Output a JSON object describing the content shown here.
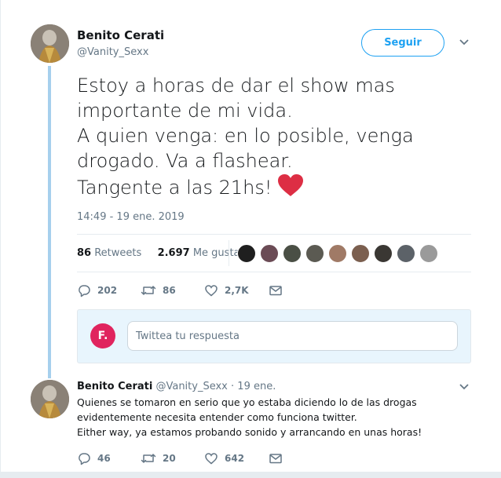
{
  "tweet": {
    "author_name": "Benito Cerati",
    "author_handle": "@Vanity_Sexx",
    "follow_label": "Seguir",
    "text_lines": [
      "Estoy a horas de dar el show mas",
      "importante de mi vida.",
      "A quien venga: en lo posible, venga",
      "drogado. Va a flashear.",
      "Tangente a las 21hs!"
    ],
    "timestamp": "14:49 - 19 ene. 2019",
    "retweets_count": "86",
    "retweets_label": "Retweets",
    "likes_count": "2.697",
    "likes_label": "Me gusta",
    "liker_colors": [
      "#1f1f1f",
      "#6b4b55",
      "#4a4f45",
      "#5b5a52",
      "#a07a66",
      "#7b5f4f",
      "#3a3733",
      "#5c6268",
      "#9a9a9a"
    ],
    "actions": {
      "replies": "202",
      "retweets": "86",
      "likes": "2,7K"
    }
  },
  "reply_composer": {
    "avatar_letter": "F.",
    "placeholder": "Twittea tu respuesta"
  },
  "reply": {
    "author_name": "Benito Cerati",
    "author_handle": "@Vanity_Sexx",
    "separator": "·",
    "date": "19 ene.",
    "text_lines": [
      "Quienes se tomaron en serio que yo estaba diciendo lo de las drogas",
      "evidentemente necesita entender como funciona twitter.",
      "Either way, ya estamos probando sonido y arrancando en unas horas!"
    ],
    "actions": {
      "replies": "46",
      "retweets": "20",
      "likes": "642"
    }
  },
  "icons": {
    "reply": "reply-icon",
    "retweet": "retweet-icon",
    "like": "heart-icon",
    "message": "envelope-icon",
    "caret": "chevron-down-icon",
    "emoji": "red-heart-emoji"
  },
  "colors": {
    "accent": "#1da1f2",
    "thread_line": "#a6d0ed",
    "emoji_heart": "#dd2e44",
    "composer_bg": "#e8f5fd",
    "composer_avatar": "#e0245e"
  }
}
